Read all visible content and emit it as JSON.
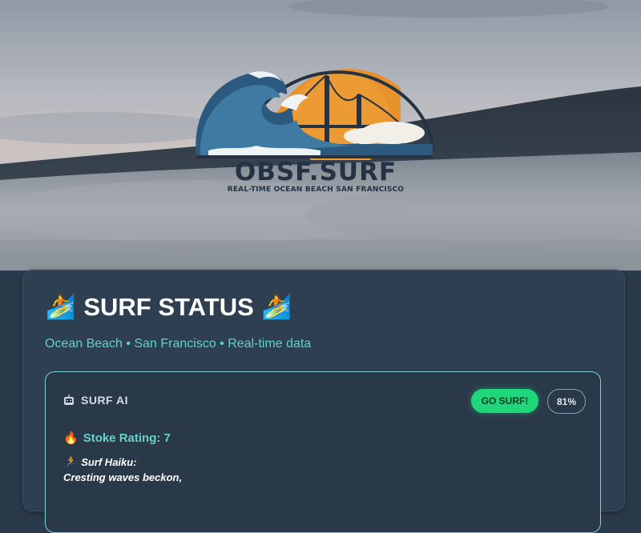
{
  "hero": {
    "logo_title": "OBSF.SURF",
    "logo_subtitle": "REAL-TIME OCEAN BEACH SAN FRANCISCO"
  },
  "status": {
    "title": "SURF STATUS",
    "subtitle": "Ocean Beach • San Francisco • Real-time data"
  },
  "ai": {
    "label": "SURF AI",
    "go_button": "GO SURF!",
    "confidence": "81%",
    "stoke_label": "Stoke Rating: 7",
    "haiku_label": "Surf Haiku:",
    "haiku_line1": "Cresting waves beckon,"
  },
  "icons": {
    "surfer": "surfer-icon",
    "robot": "robot-icon",
    "fire": "fire-icon",
    "runner": "runner-icon"
  },
  "colors": {
    "accent_teal": "#5fd4c4",
    "go_green": "#20d67a",
    "card_bg": "#2f3f52",
    "page_bg": "#2b3a4b"
  }
}
